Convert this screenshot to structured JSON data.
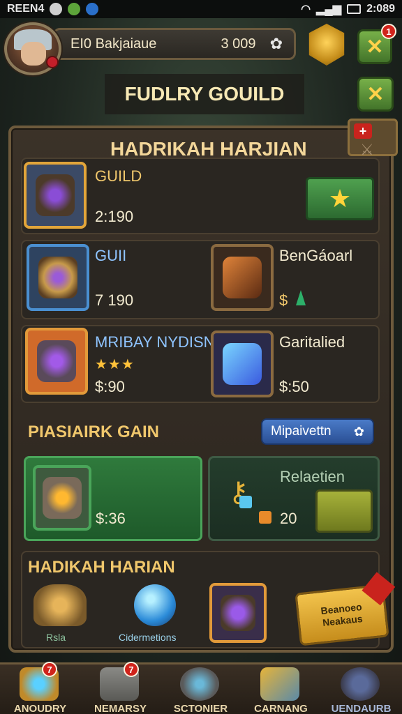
{
  "status_bar": {
    "carrier": "REEN4",
    "time": "2:089"
  },
  "header": {
    "player_name": "EI0 Bakjaiaue",
    "score": "3 009",
    "notif_count": "1"
  },
  "title": "FUDLRY GOUILD",
  "panel": {
    "heading": "HADRIKAH HARJIAN",
    "row1": {
      "label": "GUILD",
      "cost": "2:190"
    },
    "row2": {
      "left_label": "GUII",
      "left_cost": "7 190",
      "right_label": "BenGáoarl",
      "right_cost": "$"
    },
    "row3": {
      "left_label": "MRIBAY NYDISN",
      "left_cost": "$:90",
      "right_label": "Garitalied",
      "right_cost": "$:50"
    },
    "section2": {
      "heading": "PIASIAIRK GAIN",
      "button_label": "Mipaivettn",
      "green_card_value": "$:36",
      "right_label": "Relaetien",
      "right_value": "20"
    },
    "section3": {
      "heading": "HADIKAH HARIAN",
      "item1_caption": "Rsla",
      "item2_caption": "Cidermetions",
      "tag_line1": "Beanoeo",
      "tag_line2": "Neakaus"
    }
  },
  "nav": [
    {
      "label": "ANOUDRY",
      "badge": "7"
    },
    {
      "label": "NEMARSY",
      "badge": "7"
    },
    {
      "label": "SCTONIER",
      "badge": ""
    },
    {
      "label": "CARNANG",
      "badge": ""
    },
    {
      "label": "UENDAURB",
      "badge": ""
    }
  ],
  "colors": {
    "accent_gold": "#f0c76c",
    "accent_green": "#4fa04f",
    "accent_blue": "#4a7bc8",
    "notification_red": "#d0231b"
  }
}
